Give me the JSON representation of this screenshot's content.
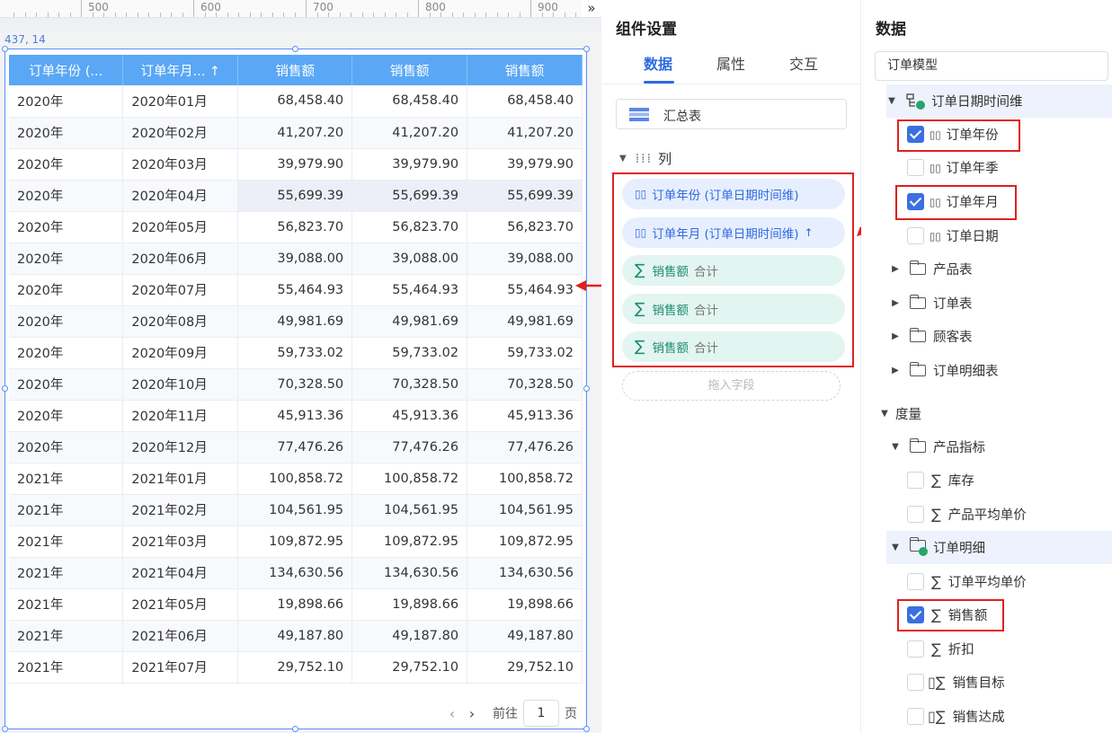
{
  "canvas": {
    "ruler_labels": [
      "500",
      "600",
      "700",
      "800",
      "900"
    ],
    "ruler_more": "»",
    "coord": "437, 14",
    "table": {
      "headers": [
        "订单年份 (...",
        "订单年月... ↑",
        "销售额",
        "销售额",
        "销售额"
      ],
      "rows": [
        [
          "2020年",
          "2020年01月",
          "68,458.40",
          "68,458.40",
          "68,458.40"
        ],
        [
          "2020年",
          "2020年02月",
          "41,207.20",
          "41,207.20",
          "41,207.20"
        ],
        [
          "2020年",
          "2020年03月",
          "39,979.90",
          "39,979.90",
          "39,979.90"
        ],
        [
          "2020年",
          "2020年04月",
          "55,699.39",
          "55,699.39",
          "55,699.39"
        ],
        [
          "2020年",
          "2020年05月",
          "56,823.70",
          "56,823.70",
          "56,823.70"
        ],
        [
          "2020年",
          "2020年06月",
          "39,088.00",
          "39,088.00",
          "39,088.00"
        ],
        [
          "2020年",
          "2020年07月",
          "55,464.93",
          "55,464.93",
          "55,464.93"
        ],
        [
          "2020年",
          "2020年08月",
          "49,981.69",
          "49,981.69",
          "49,981.69"
        ],
        [
          "2020年",
          "2020年09月",
          "59,733.02",
          "59,733.02",
          "59,733.02"
        ],
        [
          "2020年",
          "2020年10月",
          "70,328.50",
          "70,328.50",
          "70,328.50"
        ],
        [
          "2020年",
          "2020年11月",
          "45,913.36",
          "45,913.36",
          "45,913.36"
        ],
        [
          "2020年",
          "2020年12月",
          "77,476.26",
          "77,476.26",
          "77,476.26"
        ],
        [
          "2021年",
          "2021年01月",
          "100,858.72",
          "100,858.72",
          "100,858.72"
        ],
        [
          "2021年",
          "2021年02月",
          "104,561.95",
          "104,561.95",
          "104,561.95"
        ],
        [
          "2021年",
          "2021年03月",
          "109,872.95",
          "109,872.95",
          "109,872.95"
        ],
        [
          "2021年",
          "2021年04月",
          "134,630.56",
          "134,630.56",
          "134,630.56"
        ],
        [
          "2021年",
          "2021年05月",
          "19,898.66",
          "19,898.66",
          "19,898.66"
        ],
        [
          "2021年",
          "2021年06月",
          "49,187.80",
          "49,187.80",
          "49,187.80"
        ],
        [
          "2021年",
          "2021年07月",
          "29,752.10",
          "29,752.10",
          "29,752.10"
        ]
      ]
    },
    "pager": {
      "prev": "‹",
      "next": "›",
      "goto_label": "前往",
      "page": "1",
      "page_unit": "页"
    }
  },
  "settings": {
    "title": "组件设置",
    "tabs": [
      "数据",
      "属性",
      "交互"
    ],
    "summary_label": "汇总表",
    "columns_label": "列",
    "fields": [
      {
        "text": "订单年份 (订单日期时间维)",
        "kind": "dim"
      },
      {
        "text": "订单年月 (订单日期时间维)",
        "kind": "dim",
        "sort": "↑"
      },
      {
        "text": "销售额",
        "kind": "measure",
        "agg": "合计"
      },
      {
        "text": "销售额",
        "kind": "measure",
        "agg": "合计"
      },
      {
        "text": "销售额",
        "kind": "measure",
        "agg": "合计"
      }
    ],
    "drop_hint": "拖入字段"
  },
  "data_panel": {
    "title": "数据",
    "model": "订单模型",
    "tree": {
      "date_dim": "订单日期时间维",
      "date_fields": [
        {
          "label": "订单年份",
          "checked": true
        },
        {
          "label": "订单年季",
          "checked": false
        },
        {
          "label": "订单年月",
          "checked": true
        },
        {
          "label": "订单日期",
          "checked": false
        }
      ],
      "tables": [
        "产品表",
        "订单表",
        "顾客表",
        "订单明细表"
      ],
      "measures_label": "度量",
      "product_metrics": "产品指标",
      "product_measures": [
        {
          "label": "库存",
          "checked": false
        },
        {
          "label": "产品平均单价",
          "checked": false
        }
      ],
      "order_detail": "订单明细",
      "order_measures": [
        {
          "label": "订单平均单价",
          "checked": false
        },
        {
          "label": "销售额",
          "checked": true
        },
        {
          "label": "折扣",
          "checked": false
        },
        {
          "label": "销售目标",
          "checked": false
        },
        {
          "label": "销售达成",
          "checked": false
        }
      ]
    }
  },
  "colors": {
    "accent": "#2f6ae0",
    "header": "#5aa7f5",
    "highlight_red": "#e02020",
    "measure": "#1d8e6c"
  }
}
